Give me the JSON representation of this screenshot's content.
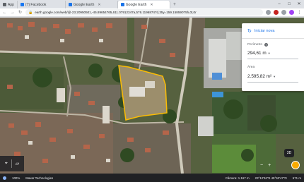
{
  "tabs": [
    {
      "label": "App",
      "favicon": "apps-icon",
      "color": "#5f6368"
    },
    {
      "label": "(7) Facebook",
      "favicon": "facebook-icon",
      "color": "#1877f2"
    },
    {
      "label": "Google Earth",
      "favicon": "google-earth-icon",
      "color": "#1a73e8"
    },
    {
      "label": "Google Earth",
      "favicon": "google-earth-icon",
      "color": "#1a73e8",
      "active": true
    }
  ],
  "toolbar": {
    "url": "earth.google.com/web/@-23.20950501,-45.89654765,611.07912347a,576.11968747d,35y,-159.15859075h,0t,0r"
  },
  "measure": {
    "new_label": "Iniciar nova",
    "perimeter_label": "Perímetro",
    "perimeter_value": "294,61 m",
    "area_label": "Área",
    "area_value": "2.595,82 m²"
  },
  "status": {
    "zoom": "100%",
    "attribution": "Maxar Technologies",
    "camera": "Câmera: 1.167 m",
    "coords": "23°12'34\"S 45°53'47\"O",
    "elevation": "571 m"
  },
  "colors": {
    "accent": "#1a73e8",
    "polygon": "#fbbc04"
  }
}
